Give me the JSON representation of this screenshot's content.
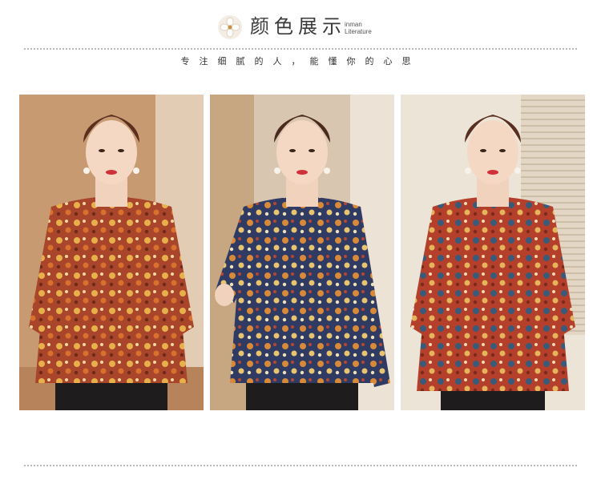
{
  "header": {
    "title": "颜色展示",
    "subtitle_line1": "inman",
    "subtitle_line2": "Literature"
  },
  "slogan": "专注细腻的人，能懂你的心思",
  "photos": [
    {
      "alt": "model-wearing-brown-floral-blouse",
      "colors": {
        "bg": "#c89a72",
        "shirt": "#a8452a",
        "accent": "#e8b04a"
      }
    },
    {
      "alt": "model-wearing-navy-floral-blouse",
      "colors": {
        "bg": "#d9c6b0",
        "shirt": "#2f3b63",
        "accent": "#d88a3a"
      }
    },
    {
      "alt": "model-wearing-red-floral-blouse",
      "colors": {
        "bg": "#e3d6c4",
        "shirt": "#b4402c",
        "accent": "#3a5a7a"
      }
    }
  ]
}
